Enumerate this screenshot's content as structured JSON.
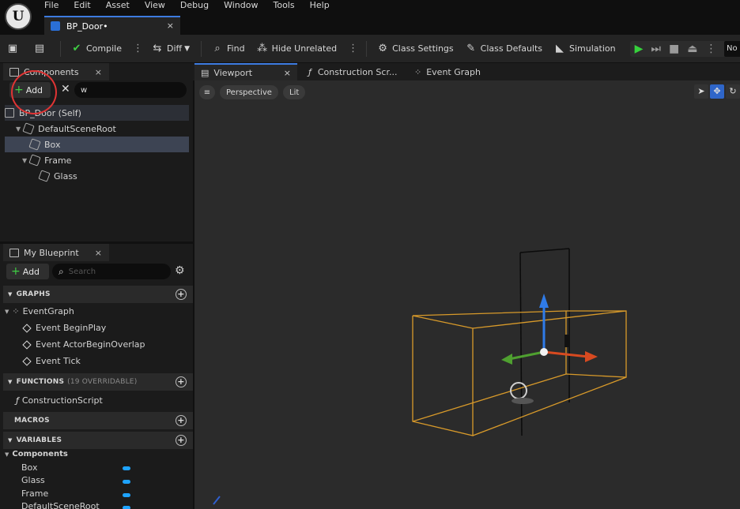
{
  "menu": [
    "File",
    "Edit",
    "Asset",
    "View",
    "Debug",
    "Window",
    "Tools",
    "Help"
  ],
  "document_tab": {
    "title": "BP_Door•",
    "close": "×"
  },
  "toolbar": {
    "compile": "Compile",
    "diff": "Diff",
    "find": "Find",
    "hide_unrelated": "Hide Unrelated",
    "class_settings": "Class Settings",
    "class_defaults": "Class Defaults",
    "simulation": "Simulation",
    "right_clipped": "No"
  },
  "components_panel": {
    "title": "Components",
    "close": "×",
    "add_label": "Add",
    "search_value": "w",
    "tree": [
      {
        "label": "BP_Door (Self)"
      },
      {
        "label": "DefaultSceneRoot"
      },
      {
        "label": "Box"
      },
      {
        "label": "Frame"
      },
      {
        "label": "Glass"
      }
    ]
  },
  "my_blueprint": {
    "title": "My Blueprint",
    "close": "×",
    "add_label": "Add",
    "search_placeholder": "Search",
    "graphs_header": "GRAPHS",
    "event_graph": "EventGraph",
    "events": [
      "Event BeginPlay",
      "Event ActorBeginOverlap",
      "Event Tick"
    ],
    "functions_header": "FUNCTIONS",
    "functions_sub": "(19 OVERRIDABLE)",
    "construction_script": "ConstructionScript",
    "macros_header": "MACROS",
    "variables_header": "VARIABLES",
    "components_group": "Components",
    "variables": [
      "Box",
      "Glass",
      "Frame",
      "DefaultSceneRoot"
    ]
  },
  "editor_tabs": {
    "viewport": "Viewport",
    "construction": "Construction Scr...",
    "event_graph": "Event Graph"
  },
  "viewport": {
    "perspective": "Perspective",
    "lit": "Lit"
  },
  "colors": {
    "accent": "#3d7be0",
    "play": "#36d13c",
    "annotation": "#e03434",
    "box_wire": "#d89a2a",
    "var_pill": "#1ea3ff"
  }
}
